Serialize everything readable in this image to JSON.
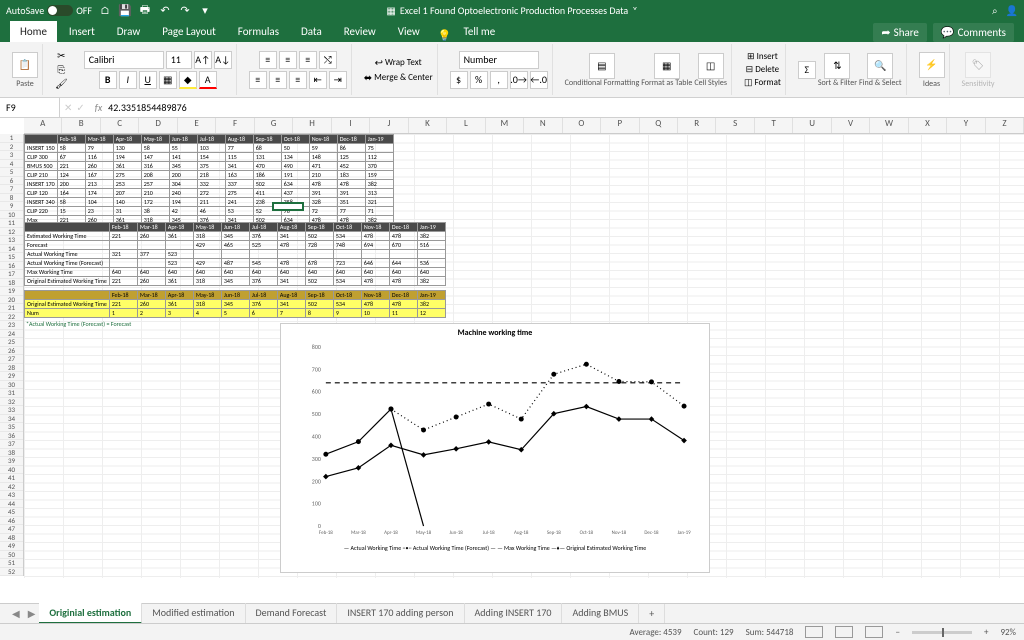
{
  "titlebar": {
    "autosave": "AutoSave",
    "off": "OFF",
    "title": "Excel 1 Found Optoelectronic Production Processes Data"
  },
  "tabs": {
    "items": [
      "Home",
      "Insert",
      "Draw",
      "Page Layout",
      "Formulas",
      "Data",
      "Review",
      "View"
    ],
    "tellme": "Tell me",
    "share": "Share",
    "comments": "Comments"
  },
  "ribbon": {
    "font": "Calibri",
    "size": "11",
    "paste": "Paste",
    "wrap": "Wrap Text",
    "merge": "Merge & Center",
    "format_group": "Number",
    "cond": "Conditional Formatting",
    "fastable": "Format as Table",
    "cellstyles": "Cell Styles",
    "insert": "Insert",
    "delete": "Delete",
    "format": "Format",
    "sort": "Sort & Filter",
    "find": "Find & Select",
    "ideas": "Ideas",
    "sens": "Sensitivity"
  },
  "formula": {
    "name": "F9",
    "value": "42.3351854489876"
  },
  "columns": [
    "A",
    "B",
    "C",
    "D",
    "E",
    "F",
    "G",
    "H",
    "I",
    "J",
    "K",
    "L",
    "M",
    "N",
    "O",
    "P",
    "Q",
    "R",
    "S",
    "T",
    "U",
    "V",
    "W",
    "X",
    "Y",
    "Z"
  ],
  "rows_count": 52,
  "table1": {
    "cols": [
      "",
      "Feb-18",
      "Mar-18",
      "Apr-18",
      "May-18",
      "Jun-18",
      "Jul-18",
      "Aug-18",
      "Sep-18",
      "Oct-18",
      "Nov-18",
      "Dec-18",
      "Jan-19"
    ],
    "rows": [
      [
        "INSERT 150",
        "58",
        "79",
        "130",
        "58",
        "55",
        "103",
        "77",
        "68",
        "50",
        "59",
        "86",
        "75"
      ],
      [
        "CLIP 300",
        "67",
        "116",
        "194",
        "147",
        "141",
        "154",
        "115",
        "131",
        "134",
        "148",
        "125",
        "112"
      ],
      [
        "BMUS 500",
        "221",
        "260",
        "361",
        "316",
        "345",
        "375",
        "341",
        "470",
        "490",
        "471",
        "452",
        "370"
      ],
      [
        "CLIP 210",
        "124",
        "167",
        "275",
        "208",
        "200",
        "218",
        "163",
        "186",
        "191",
        "210",
        "183",
        "159"
      ],
      [
        "INSERT 170",
        "200",
        "213",
        "253",
        "257",
        "304",
        "332",
        "337",
        "502",
        "634",
        "478",
        "478",
        "382"
      ],
      [
        "CLIP 120",
        "164",
        "174",
        "207",
        "210",
        "240",
        "272",
        "275",
        "411",
        "437",
        "391",
        "391",
        "313"
      ],
      [
        "INSERT 340",
        "58",
        "104",
        "140",
        "172",
        "194",
        "211",
        "241",
        "238",
        "358",
        "328",
        "351",
        "321"
      ],
      [
        "CLIP 220",
        "15",
        "23",
        "31",
        "38",
        "42",
        "46",
        "53",
        "52",
        "78",
        "72",
        "77",
        "71"
      ],
      [
        "Max",
        "221",
        "260",
        "361",
        "318",
        "345",
        "376",
        "341",
        "502",
        "634",
        "478",
        "478",
        "382"
      ]
    ]
  },
  "table2": {
    "cols": [
      "",
      "Feb-18",
      "Mar-18",
      "Apr-18",
      "May-18",
      "Jun-18",
      "Jul-18",
      "Aug-18",
      "Sep-18",
      "Oct-18",
      "Nov-18",
      "Dec-18",
      "Jan-19"
    ],
    "rows": [
      [
        "Estimated Working Time",
        "221",
        "260",
        "361",
        "318",
        "345",
        "376",
        "341",
        "502",
        "534",
        "478",
        "478",
        "382"
      ],
      [
        "Forecast",
        "",
        "",
        "",
        "429",
        "465",
        "525",
        "478",
        "728",
        "748",
        "694",
        "670",
        "516"
      ],
      [
        "Actual Working Time",
        "321",
        "377",
        "523",
        "",
        "",
        "",
        "",
        "",
        "",
        "",
        "",
        ""
      ],
      [
        "Actual Working Time (Forecast)",
        "",
        "",
        "523",
        "429",
        "487",
        "545",
        "478",
        "678",
        "723",
        "646",
        "644",
        "536"
      ],
      [
        "Max Working Time",
        "640",
        "640",
        "640",
        "640",
        "640",
        "640",
        "640",
        "640",
        "640",
        "640",
        "640",
        "640"
      ],
      [
        "Original Estimated Working Time",
        "221",
        "260",
        "361",
        "318",
        "345",
        "376",
        "341",
        "502",
        "534",
        "478",
        "478",
        "382"
      ]
    ]
  },
  "table3": {
    "cols": [
      "",
      "Feb-18",
      "Mar-18",
      "Apr-18",
      "May-18",
      "Jun-18",
      "Jul-18",
      "Aug-18",
      "Sep-18",
      "Oct-18",
      "Nov-18",
      "Dec-18",
      "Jan-19"
    ],
    "rows": [
      [
        "Original Estimated Working Time",
        "221",
        "260",
        "361",
        "318",
        "345",
        "376",
        "341",
        "502",
        "534",
        "478",
        "478",
        "382"
      ],
      [
        "Num",
        "1",
        "2",
        "3",
        "4",
        "5",
        "6",
        "7",
        "8",
        "9",
        "10",
        "11",
        "12"
      ]
    ]
  },
  "note": "*Actual Working Time (Forecast) = Forecast",
  "chart_data": {
    "type": "line",
    "title": "Machine working time",
    "categories": [
      "Feb-18",
      "Mar-18",
      "Apr-18",
      "May-18",
      "Jun-18",
      "Jul-18",
      "Aug-18",
      "Sep-18",
      "Oct-18",
      "Nov-18",
      "Dec-18",
      "Jan-19"
    ],
    "ylim": [
      0,
      800
    ],
    "yticks": [
      0,
      100,
      200,
      300,
      400,
      500,
      600,
      700,
      800
    ],
    "series": [
      {
        "name": "Actual Working Time",
        "values": [
          321,
          377,
          523,
          null,
          null,
          null,
          null,
          null,
          null,
          null,
          null,
          null
        ],
        "style": "solid-dot"
      },
      {
        "name": "Actual Working Time (Forecast)",
        "values": [
          null,
          null,
          523,
          429,
          487,
          545,
          478,
          678,
          723,
          646,
          644,
          536
        ],
        "style": "dotted-dot"
      },
      {
        "name": "Max Working Time",
        "values": [
          640,
          640,
          640,
          640,
          640,
          640,
          640,
          640,
          640,
          640,
          640,
          640
        ],
        "style": "dashed"
      },
      {
        "name": "Original Estimated Working Time",
        "values": [
          221,
          260,
          361,
          318,
          345,
          376,
          341,
          502,
          534,
          478,
          478,
          382
        ],
        "style": "solid-diamond"
      }
    ],
    "legend": "— Actual Working Time   ··•·· Actual Working Time (Forecast)   — — Max Working Time   —♦— Original Estimated Working Time"
  },
  "sheets": [
    "Originial estimation",
    "Modified estimation",
    "Demand Forecast",
    "INSERT 170 adding person",
    "Adding INSERT 170",
    "Adding BMUS"
  ],
  "status": {
    "avg": "Average: 4539",
    "count": "Count: 129",
    "sum": "Sum: 544718",
    "zoom": "92%"
  }
}
